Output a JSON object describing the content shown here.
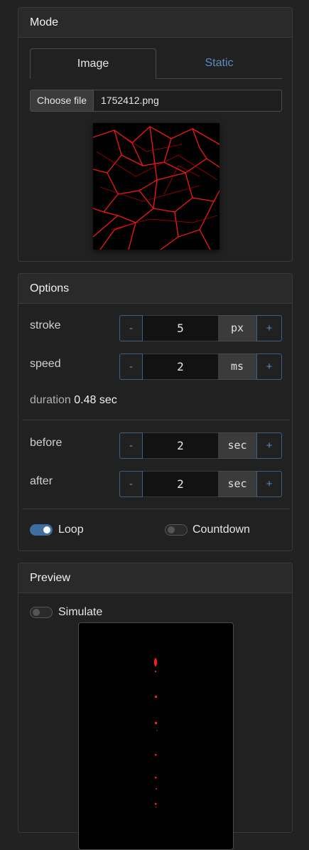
{
  "mode": {
    "header": "Mode",
    "tabs": [
      {
        "label": "Image",
        "active": true
      },
      {
        "label": "Static",
        "active": false
      }
    ],
    "file": {
      "button_label": "Choose file",
      "file_name": "1752412.png"
    }
  },
  "options": {
    "header": "Options",
    "stroke": {
      "label": "stroke",
      "minus": "-",
      "value": "5",
      "unit": "px",
      "plus": "+"
    },
    "speed": {
      "label": "speed",
      "minus": "-",
      "value": "2",
      "unit": "ms",
      "plus": "+"
    },
    "duration": {
      "label": "duration",
      "value": "0.48 sec"
    },
    "before": {
      "label": "before",
      "minus": "-",
      "value": "2",
      "unit": "sec",
      "plus": "+"
    },
    "after": {
      "label": "after",
      "minus": "-",
      "value": "2",
      "unit": "sec",
      "plus": "+"
    },
    "loop": {
      "label": "Loop",
      "on": true
    },
    "countdown": {
      "label": "Countdown",
      "on": false
    }
  },
  "preview": {
    "header": "Preview",
    "simulate": {
      "label": "Simulate",
      "on": false
    }
  },
  "colors": {
    "accent": "#5b8dc0",
    "toggle_on": "#3d6e9f",
    "stroke_red": "#ff1a1a"
  }
}
